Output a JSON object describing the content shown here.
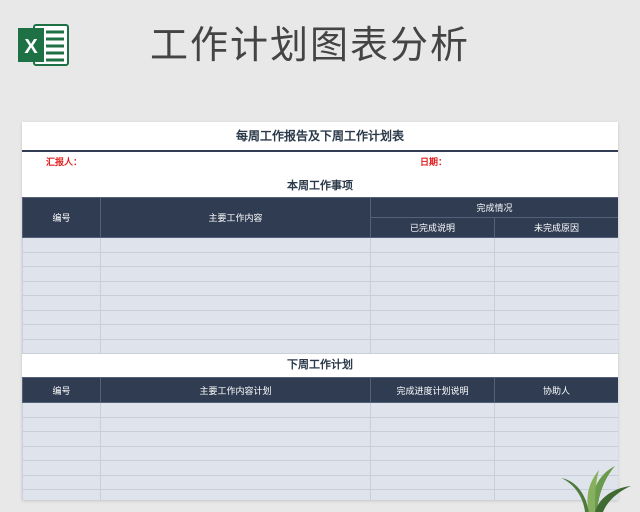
{
  "header": {
    "title": "工作计划图表分析",
    "logo_icon": "excel-logo-icon",
    "logo_letter": "X"
  },
  "sheet": {
    "title": "每周工作报告及下周工作计划表",
    "reporter_label": "汇报人：",
    "date_label": "日期：",
    "this_week": {
      "section_title": "本周工作事项",
      "columns": {
        "number": "编号",
        "content": "主要工作内容",
        "completion": "完成情况",
        "completed_note": "已完成说明",
        "incomplete_reason": "未完成原因"
      },
      "row_count": 8
    },
    "next_week": {
      "section_title": "下周工作计划",
      "columns": {
        "number": "编号",
        "content_plan": "主要工作内容计划",
        "progress_plan": "完成进度计划说明",
        "assistant": "协助人"
      },
      "row_count": 7
    }
  },
  "colors": {
    "header_bg": "#2f3c52",
    "row_bg": "#dfe4ec",
    "red_label": "#e02020",
    "excel_green": "#1e7145"
  },
  "decor": {
    "plant_icon": "plant-icon"
  }
}
